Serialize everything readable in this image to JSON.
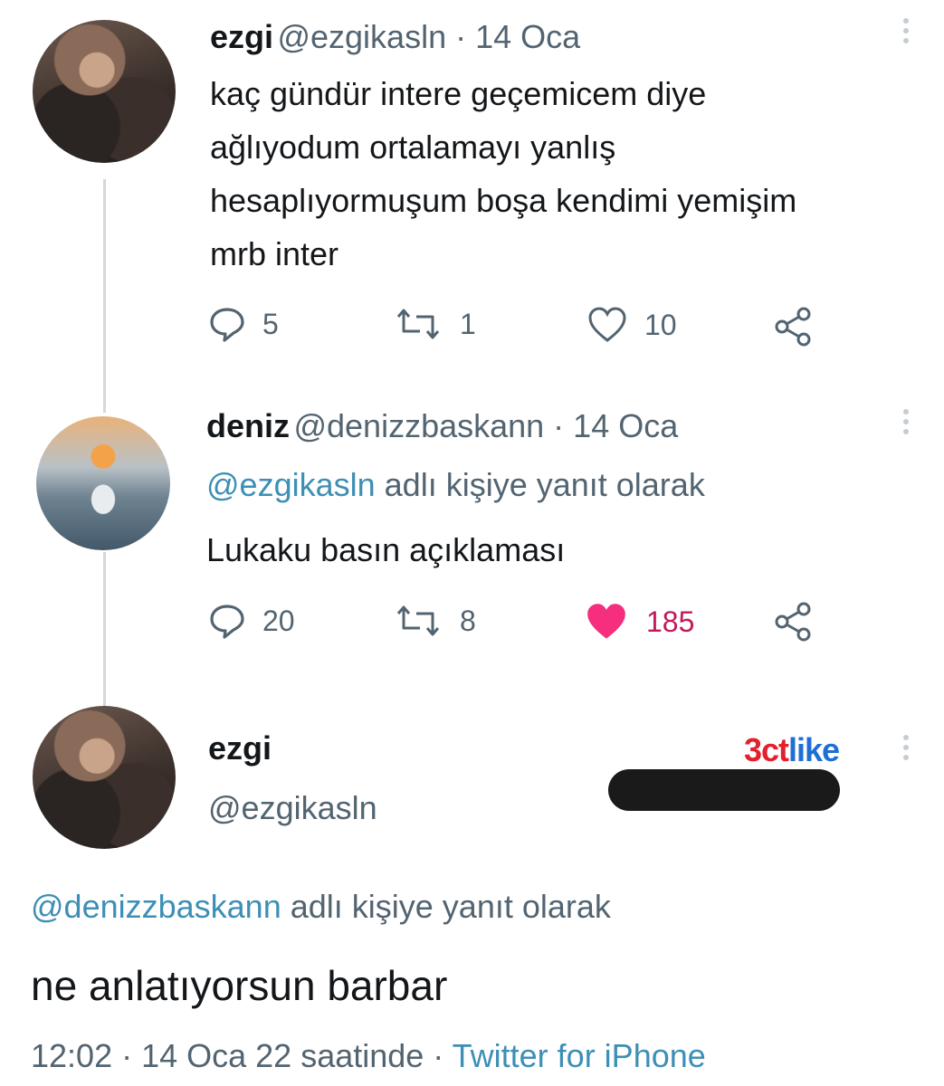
{
  "tweet1": {
    "name": "ezgi",
    "meta": "@ezgikasln · 14 Oca",
    "lines": [
      "kaç gündür intere geçemicem diye",
      "ağlıyodum ortalamayı yanlış",
      "hesaplıyormuşum boşa kendimi yemişim",
      "mrb inter"
    ],
    "actions": {
      "replies": "5",
      "retweets": "1",
      "likes": "10"
    },
    "icons": [
      "comment-icon",
      "retweet-icon",
      "heart-icon",
      "share-icon"
    ]
  },
  "tweet2": {
    "name": "deniz",
    "meta": "@denizzbaskann · 14 Oca",
    "reply_mention": "@ezgikasln",
    "reply_suffix": "adlı kişiye yanıt olarak",
    "text": "Lukaku basın açıklaması",
    "actions": {
      "replies": "20",
      "retweets": "8",
      "likes": "185"
    },
    "liked_color": "#e0245e"
  },
  "tweet3": {
    "name": "ezgi",
    "handle": "@ezgikasln",
    "reply_mention": "@denizzbaskann",
    "reply_suffix": "adlı kişiye yanıt olarak",
    "text": "ne anlatıyorsun barbar",
    "time": "12:02 · 14 Oca 22 saatinde ·",
    "source": "Twitter for iPhone"
  },
  "watermark": {
    "part1": "3ct",
    "part2": "like",
    "color1": "#e3202c",
    "color2": "#1d6fd6"
  },
  "colors": {
    "mention": "#3d8fb5",
    "muted": "#536471",
    "thread_line": "#d2d8dc"
  }
}
